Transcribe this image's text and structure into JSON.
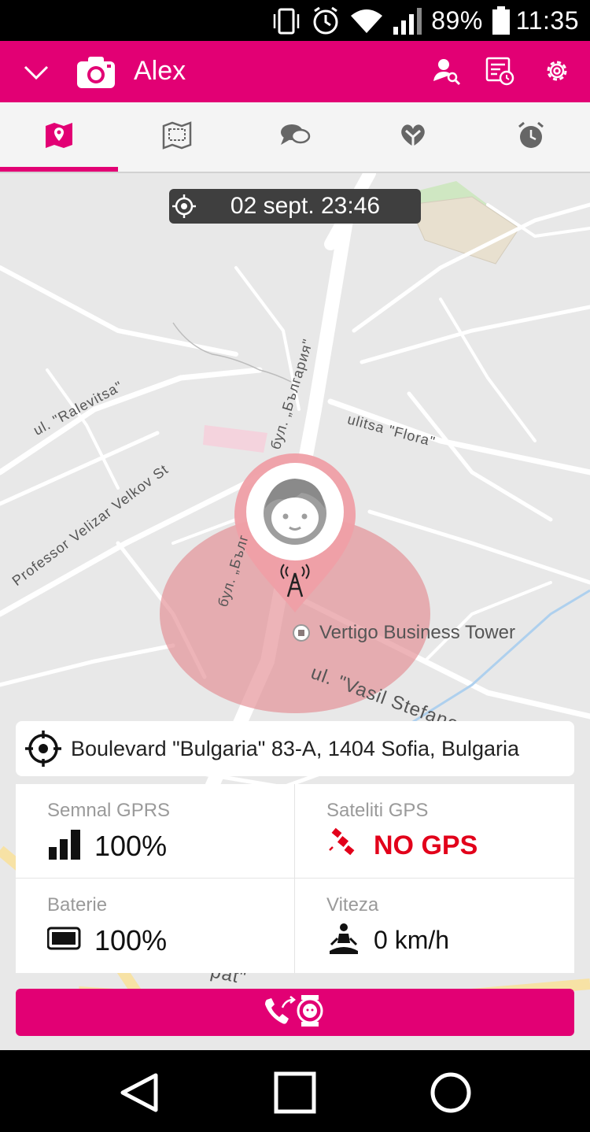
{
  "status_bar": {
    "battery_percent": "89%",
    "time": "11:35",
    "icons": [
      "vibrate-icon",
      "alarm-icon",
      "wifi-icon",
      "signal-icon",
      "battery-icon"
    ]
  },
  "app_bar": {
    "title": "Alex",
    "background": "#e20074",
    "icons": [
      "chevron-down-icon",
      "camera-icon",
      "user-search-icon",
      "history-icon",
      "gear-icon"
    ]
  },
  "tabs": [
    {
      "name": "map-tab",
      "icon": "map-pin-icon",
      "active": true
    },
    {
      "name": "geofence-tab",
      "icon": "map-area-icon",
      "active": false
    },
    {
      "name": "chat-tab",
      "icon": "chat-icon",
      "active": false
    },
    {
      "name": "favorites-tab",
      "icon": "heart-icon",
      "active": false
    },
    {
      "name": "alarm-tab",
      "icon": "alarm-clock-icon",
      "active": false
    }
  ],
  "map": {
    "timestamp": "02 sept. 23:46",
    "place_name": "Vertigo Business Tower",
    "street_labels": [
      "ul. \"Ralevitsa\"",
      "бул. „България\"",
      "ulitsa \"Flora\"",
      "Professor Velizar Velkov St",
      "бул. „Бълг",
      "ul. \"Vasil Stefanov\"",
      "pat\""
    ]
  },
  "address": {
    "text": "Boulevard \"Bulgaria\" 83-A, 1404 Sofia, Bulgaria"
  },
  "info": {
    "gprs": {
      "label": "Semnal GPRS",
      "value": "100%"
    },
    "gps": {
      "label": "Sateliti GPS",
      "value": "NO GPS",
      "color": "#e2001a"
    },
    "battery": {
      "label": "Baterie",
      "value": "100%"
    },
    "speed": {
      "label": "Viteza",
      "value": "0 km/h"
    }
  },
  "call_button": {
    "icon": "call-watch-icon"
  },
  "nav_bar": {
    "icons": [
      "back-icon",
      "home-icon",
      "recents-icon"
    ]
  }
}
